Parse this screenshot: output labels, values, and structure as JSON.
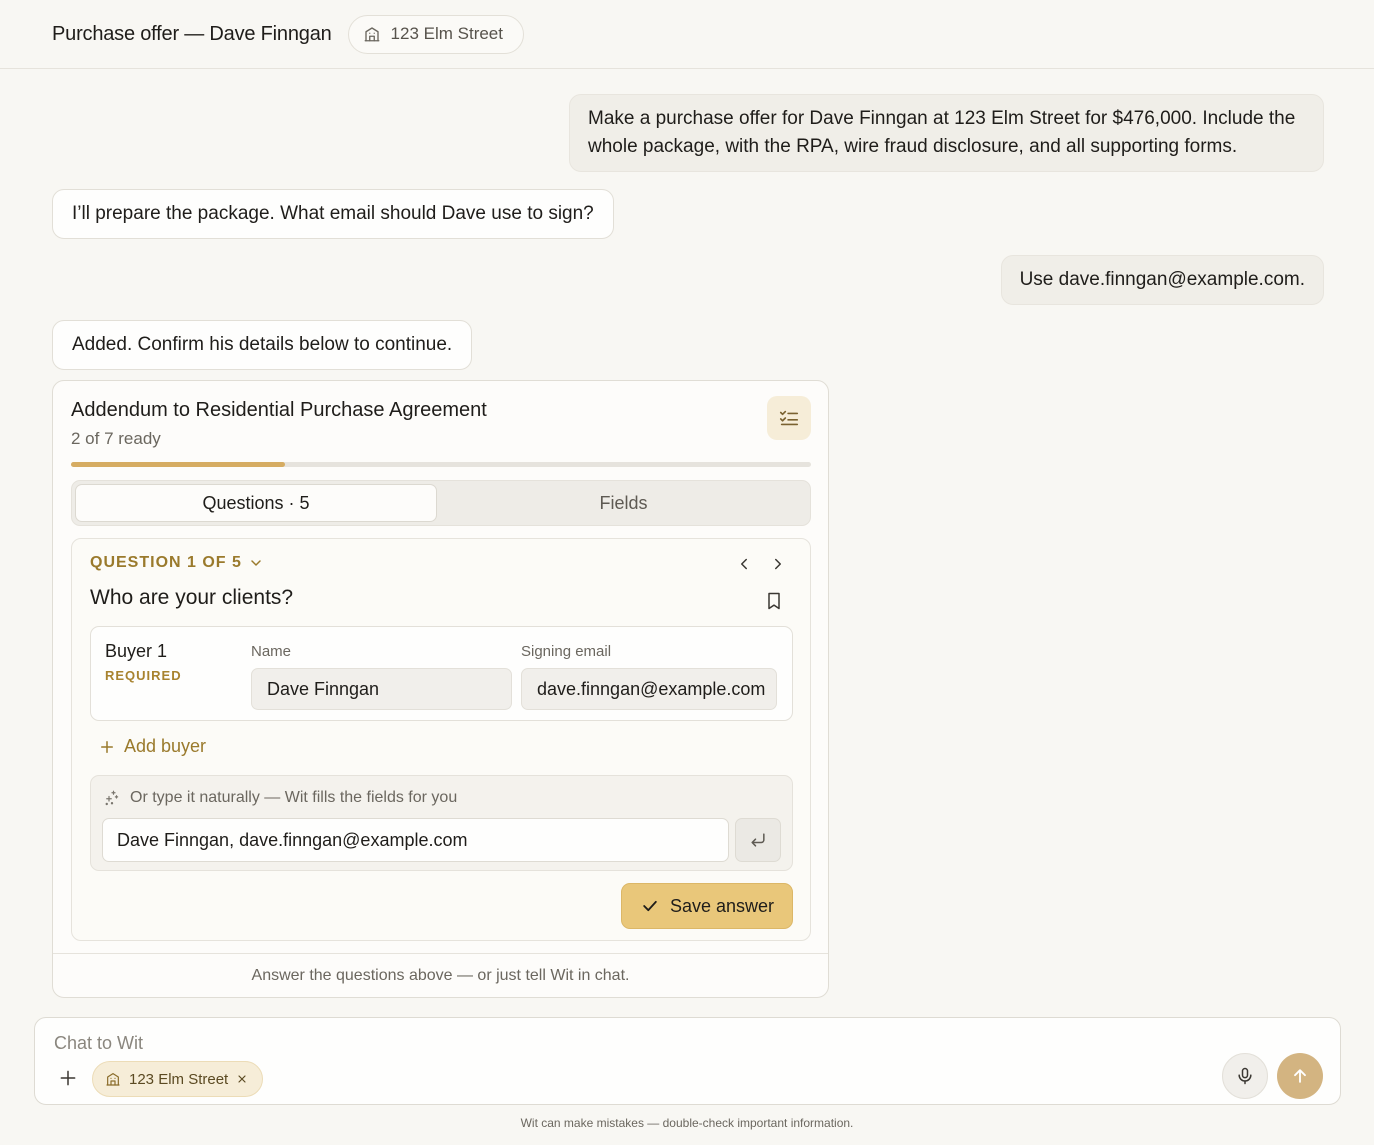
{
  "header": {
    "title": "Purchase offer — Dave Finngan",
    "property_chip": "123 Elm Street"
  },
  "messages": [
    {
      "role": "user",
      "text": "Make a purchase offer for Dave Finngan at 123 Elm Street for $476,000. Include the whole package, with the RPA, wire fraud disclosure, and all supporting forms."
    },
    {
      "role": "assistant",
      "text": "I’ll prepare the package. What email should Dave use to sign?"
    },
    {
      "role": "user",
      "text": "Use dave.finngan@example.com."
    },
    {
      "role": "assistant",
      "text": "Added. Confirm his details below to continue."
    }
  ],
  "form_card": {
    "title": "Addendum to Residential Purchase Agreement",
    "status": "2 of 7 ready",
    "progress": 0.2889,
    "tabs": [
      {
        "label": "Questions · 5",
        "active": true
      },
      {
        "label": "Fields",
        "active": false
      }
    ],
    "question": {
      "counter": "QUESTION 1 OF 5",
      "title": "Who are your clients?",
      "buyer": {
        "label": "Buyer 1",
        "required": "REQUIRED",
        "name_label": "Name",
        "name_value": "Dave Finngan",
        "email_label": "Signing email",
        "email_value": "dave.finngan@example.com"
      },
      "add_buyer": "Add buyer",
      "natural_label": "Or type it naturally — Wit fills the fields for you",
      "natural_value": "Dave Finngan, dave.finngan@example.com",
      "save_label": "Save answer"
    },
    "footer": "Answer the questions above — or just tell Wit in chat."
  },
  "composer": {
    "placeholder": "Chat to Wit",
    "chip": "123 Elm Street"
  },
  "disclaimer": "Wit can make mistakes — double-check important information.",
  "colors": {
    "accent": "#d6ac62",
    "accent_text": "#9a7a2c",
    "background": "#f8f7f3"
  }
}
